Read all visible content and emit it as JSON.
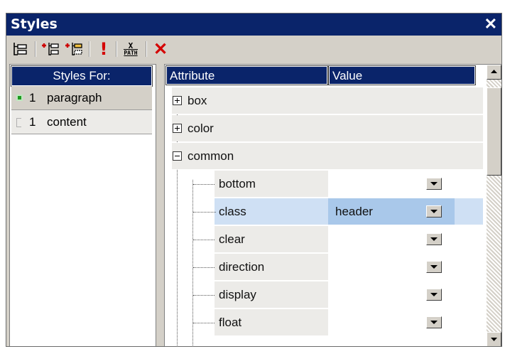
{
  "window": {
    "title": "Styles",
    "close_glyph": "✕"
  },
  "toolbar": {
    "buttons": [
      {
        "icon": "new-selector-icon"
      },
      {
        "icon": "insert-selector-icon"
      },
      {
        "icon": "append-selector-icon"
      },
      {
        "icon": "important-icon",
        "glyph": "!"
      },
      {
        "icon": "xpath-icon",
        "glyph_top": "X",
        "glyph_bottom": "PATH"
      },
      {
        "icon": "delete-icon",
        "glyph": "✕"
      }
    ]
  },
  "left_pane": {
    "header": "Styles For:",
    "items": [
      {
        "count": "1",
        "label": "paragraph",
        "selected": true,
        "marker_color": "#1f9a1f"
      },
      {
        "count": "1",
        "label": "content",
        "selected": false,
        "marker_color": "#b0b0b0"
      }
    ]
  },
  "right_pane": {
    "columns": {
      "attribute": "Attribute",
      "value": "Value"
    },
    "groups": [
      {
        "name": "box",
        "expanded": false
      },
      {
        "name": "color",
        "expanded": false
      },
      {
        "name": "common",
        "expanded": true
      }
    ],
    "properties": [
      {
        "name": "bottom",
        "value": ""
      },
      {
        "name": "class",
        "value": "header",
        "selected": true
      },
      {
        "name": "clear",
        "value": ""
      },
      {
        "name": "direction",
        "value": ""
      },
      {
        "name": "display",
        "value": ""
      },
      {
        "name": "float",
        "value": ""
      }
    ]
  },
  "colors": {
    "title_bar": "#0a246a",
    "selection": "#cfe0f4",
    "selected_value": "#a9c8ea"
  }
}
